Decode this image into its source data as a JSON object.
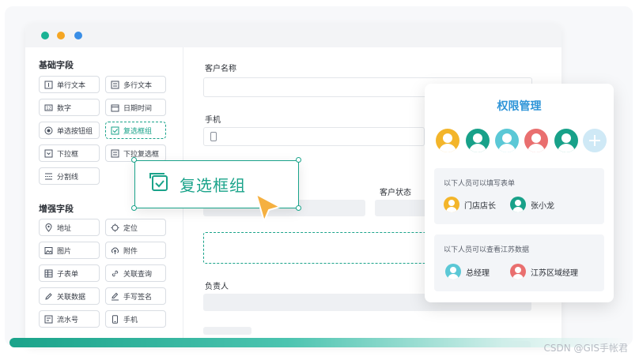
{
  "sidebar": {
    "basic_title": "基础字段",
    "basic_fields": [
      {
        "label": "单行文本",
        "icon": "single-line-text-icon"
      },
      {
        "label": "多行文本",
        "icon": "multi-line-text-icon"
      },
      {
        "label": "数字",
        "icon": "number-icon"
      },
      {
        "label": "日期时间",
        "icon": "calendar-icon"
      },
      {
        "label": "单选按钮组",
        "icon": "radio-icon"
      },
      {
        "label": "复选框组",
        "icon": "checkbox-icon"
      },
      {
        "label": "下拉框",
        "icon": "dropdown-icon"
      },
      {
        "label": "下拉复选框",
        "icon": "dropdown-checkbox-icon"
      },
      {
        "label": "分割线",
        "icon": "divider-icon"
      }
    ],
    "enhanced_title": "增强字段",
    "enhanced_fields": [
      {
        "label": "地址",
        "icon": "location-pin-icon"
      },
      {
        "label": "定位",
        "icon": "crosshair-icon"
      },
      {
        "label": "图片",
        "icon": "image-icon"
      },
      {
        "label": "附件",
        "icon": "cloud-upload-icon"
      },
      {
        "label": "子表单",
        "icon": "subform-icon"
      },
      {
        "label": "关联查询",
        "icon": "link-icon"
      },
      {
        "label": "关联数据",
        "icon": "pen-icon"
      },
      {
        "label": "手写签名",
        "icon": "pen-line-icon"
      },
      {
        "label": "流水号",
        "icon": "serial-number-icon"
      },
      {
        "label": "手机",
        "icon": "phone-icon"
      }
    ]
  },
  "form": {
    "customer_name_label": "客户名称",
    "phone_label": "手机",
    "customer_status_label": "客户状态",
    "owner_label": "负责人"
  },
  "drag_card": {
    "label": "复选框组",
    "icon": "checkbox-icon"
  },
  "permission": {
    "title": "权限管理",
    "fill_hint": "以下人员可以填写表单",
    "fill_people": [
      "门店店长",
      "张小龙"
    ],
    "view_hint": "以下人员可以查看江苏数据",
    "view_people": [
      "总经理",
      "江苏区域经理"
    ]
  },
  "watermark": "CSDN @GIS手帐君",
  "colors": {
    "accent": "#1aa38a",
    "title_blue": "#2f95d8",
    "cursor": "#f5b040",
    "dot_green": "#1ab394",
    "dot_orange": "#f5a623",
    "dot_blue": "#3a8ee6"
  }
}
